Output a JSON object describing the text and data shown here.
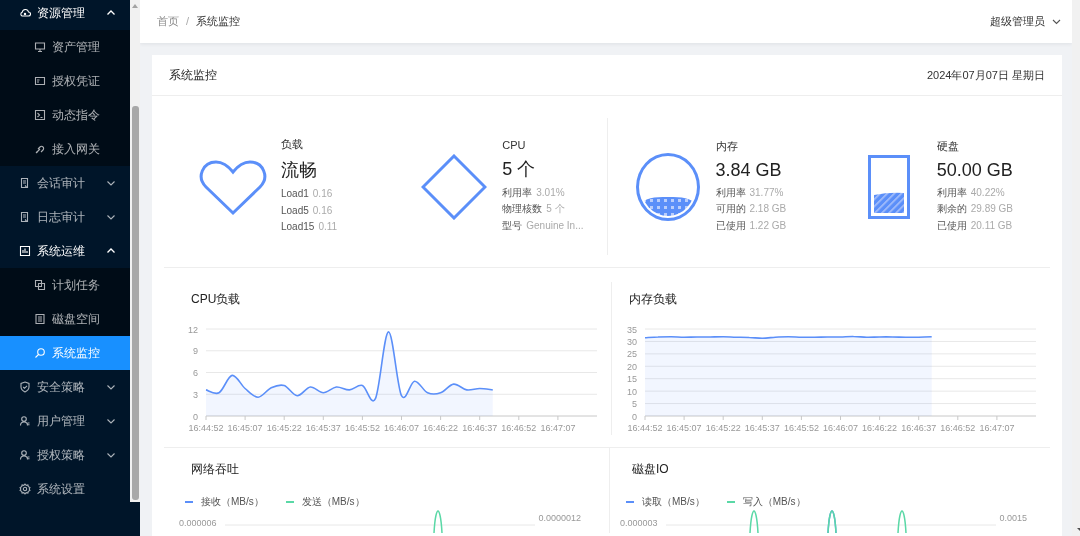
{
  "sidebar": {
    "items": [
      {
        "kind": "group",
        "label": "资源管理",
        "expanded": true,
        "children": [
          {
            "label": "资产管理",
            "selected": false
          },
          {
            "label": "授权凭证",
            "selected": false
          },
          {
            "label": "动态指令",
            "selected": false
          },
          {
            "label": "接入网关",
            "selected": false
          }
        ]
      },
      {
        "kind": "group",
        "label": "会话审计",
        "expanded": false
      },
      {
        "kind": "group",
        "label": "日志审计",
        "expanded": false
      },
      {
        "kind": "group",
        "label": "系统运维",
        "expanded": true,
        "children": [
          {
            "label": "计划任务",
            "selected": false
          },
          {
            "label": "磁盘空间",
            "selected": false
          },
          {
            "label": "系统监控",
            "selected": true
          }
        ]
      },
      {
        "kind": "group",
        "label": "安全策略",
        "expanded": false
      },
      {
        "kind": "group",
        "label": "用户管理",
        "expanded": false
      },
      {
        "kind": "group",
        "label": "授权策略",
        "expanded": false
      },
      {
        "kind": "link",
        "label": "系统设置",
        "selected": false
      }
    ]
  },
  "header": {
    "breadcrumb": [
      "首页",
      "系统监控"
    ],
    "separator": "/",
    "user": "超级管理员"
  },
  "panel": {
    "title": "系统监控",
    "date": "2024年07月07日 星期日",
    "stats": [
      {
        "kind": "load",
        "title": "负载",
        "value": "流畅",
        "details": [
          {
            "label": "Load1",
            "value": "0.16"
          },
          {
            "label": "Load5",
            "value": "0.16"
          },
          {
            "label": "Load15",
            "value": "0.11"
          }
        ]
      },
      {
        "kind": "cpu",
        "title": "CPU",
        "value": "5 个",
        "details": [
          {
            "label": "利用率",
            "value": "3.01%"
          },
          {
            "label": "物理核数",
            "value": "5 个"
          },
          {
            "label": "型号",
            "value": "Genuine In..."
          }
        ]
      },
      {
        "kind": "memory",
        "title": "内存",
        "value": "3.84 GB",
        "level": 0.3177,
        "details": [
          {
            "label": "利用率",
            "value": "31.77%"
          },
          {
            "label": "可用的",
            "value": "2.18 GB"
          },
          {
            "label": "已使用",
            "value": "1.22 GB"
          }
        ]
      },
      {
        "kind": "disk",
        "title": "硬盘",
        "value": "50.00 GB",
        "level": 0.4022,
        "details": [
          {
            "label": "利用率",
            "value": "40.22%"
          },
          {
            "label": "剩余的",
            "value": "29.89 GB"
          },
          {
            "label": "已使用",
            "value": "20.11 GB"
          }
        ]
      }
    ],
    "charts": [
      {
        "title": "CPU负载",
        "chart_data": {
          "type": "area",
          "categories": [
            "16:44:52",
            null,
            null,
            "16:45:07",
            null,
            null,
            "16:45:22",
            null,
            null,
            "16:45:37",
            null,
            null,
            "16:45:52",
            null,
            null,
            "16:46:07",
            null,
            null,
            "16:46:22",
            null,
            null,
            "16:46:37",
            null,
            null,
            "16:46:52",
            null,
            null,
            "16:47:07",
            null,
            null
          ],
          "series": [
            {
              "color": "#5b8ff9",
              "values": [
                3.6,
                3.2,
                5.6,
                3.8,
                2.6,
                3.9,
                4.2,
                2.8,
                4.0,
                3.2,
                4.0,
                3.6,
                4.2,
                2.4,
                11.6,
                2.8,
                4.8,
                3.2,
                3.2,
                4.4,
                3.6,
                3.8,
                3.6,
                null,
                null,
                null,
                null,
                null,
                null,
                null
              ]
            }
          ],
          "ylim": [
            0,
            12
          ],
          "yticks": [
            0,
            3,
            6,
            9,
            12
          ],
          "grid": true
        }
      },
      {
        "title": "内存负载",
        "chart_data": {
          "type": "area",
          "categories": [
            "16:44:52",
            null,
            null,
            "16:45:07",
            null,
            null,
            "16:45:22",
            null,
            null,
            "16:45:37",
            null,
            null,
            "16:45:52",
            null,
            null,
            "16:46:07",
            null,
            null,
            "16:46:22",
            null,
            null,
            "16:46:37",
            null,
            null,
            "16:46:52",
            null,
            null,
            "16:47:07",
            null,
            null
          ],
          "series": [
            {
              "color": "#5b8ff9",
              "values": [
                31.5,
                31.8,
                31.9,
                31.7,
                31.8,
                31.8,
                31.9,
                31.7,
                31.6,
                31.3,
                31.7,
                31.9,
                31.7,
                31.7,
                31.8,
                31.8,
                32.0,
                31.7,
                31.8,
                31.8,
                31.7,
                31.7,
                31.9,
                null,
                null,
                null,
                null,
                null,
                null,
                null
              ]
            }
          ],
          "ylim": [
            0,
            35
          ],
          "yticks": [
            0,
            5,
            10,
            15,
            20,
            25,
            30,
            35
          ],
          "grid": true
        }
      }
    ],
    "io": [
      {
        "title": "网络吞吐",
        "legend": [
          {
            "label": "接收（MB/s）",
            "color": "#5b8ff9"
          },
          {
            "label": "发送（MB/s）",
            "color": "#5ad8a6"
          }
        ],
        "left_axis_label": "0.000006",
        "right_axis_label": "0.0000012"
      },
      {
        "title": "磁盘IO",
        "legend": [
          {
            "label": "读取（MB/s）",
            "color": "#5b8ff9"
          },
          {
            "label": "写入（MB/s）",
            "color": "#5ad8a6"
          }
        ],
        "left_axis_label": "0.000003",
        "right_axis_label": "0.0015"
      }
    ]
  }
}
